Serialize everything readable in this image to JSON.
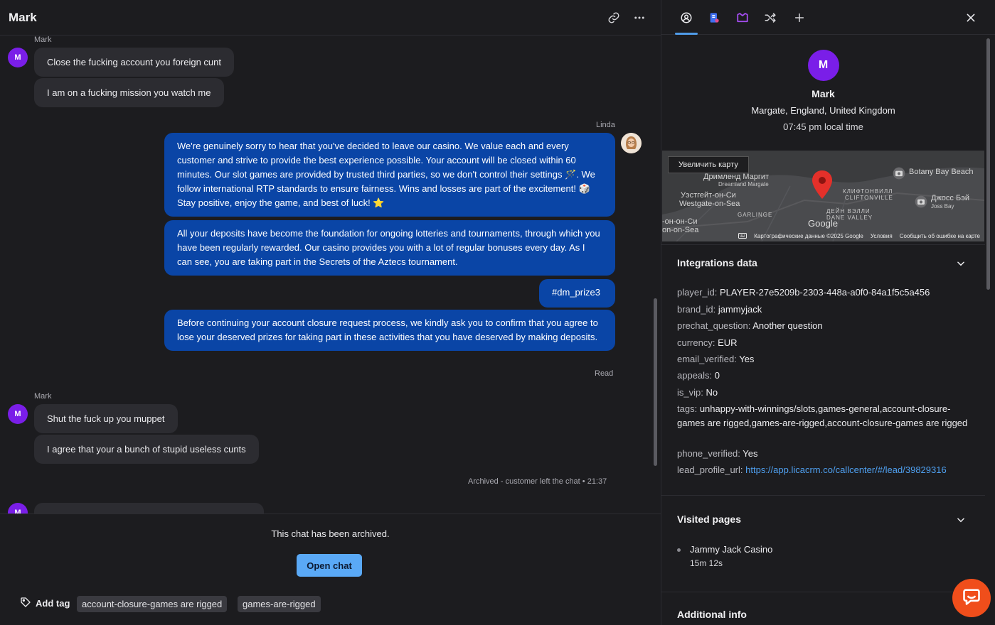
{
  "chat": {
    "title": "Mark",
    "messages_block1": {
      "author": "Mark",
      "avatar_letter": "M",
      "lines": [
        "Close the fucking account you foreign cunt",
        "I am on a fucking mission you watch me"
      ]
    },
    "agent_block": {
      "author": "Linda",
      "msg1": "We're genuinely sorry to hear that you've decided to leave our casino. We value each and every customer and strive to provide the best experience possible. Your account will be closed within 60 minutes. Our slot games are provided by trusted third parties, so we don't control their settings 🪄. We follow international RTP standards to ensure fairness. Wins and losses are part of the excitement! 🎲 Stay positive, enjoy the game, and best of luck! ⭐",
      "msg2": "All your deposits have become the foundation for ongoing lotteries and tournaments, through which you have been regularly rewarded. Our casino provides you with a lot of regular bonuses every day. As I can see, you are taking part in the Secrets of the Aztecs tournament.",
      "msg3": "#dm_prize3",
      "msg4": "Before continuing your account closure request process, we kindly ask you to confirm that you agree to lose your deserved prizes for taking part in these activities that you have deserved by making deposits.",
      "status": "Read"
    },
    "messages_block2": {
      "author": "Mark",
      "avatar_letter": "M",
      "lines": [
        "Shut the fuck up you muppet",
        "I agree that your a bunch of stupid useless cunts"
      ]
    },
    "archived_note": "Archived - customer left the chat • 21:37",
    "partial_avatar_letter": "M",
    "composer": {
      "archived_text": "This chat has been archived.",
      "open_chat": "Open chat",
      "add_tag": "Add tag",
      "tags": [
        "account-closure-games are rigged",
        "games-are-rigged"
      ]
    }
  },
  "side": {
    "profile": {
      "letter": "M",
      "name": "Mark",
      "location": "Margate, England, United Kingdom",
      "local_time": "07:45 pm local time"
    },
    "map": {
      "enlarge": "Увеличить карту",
      "labels": [
        "Дримленд Маргит",
        "Dreamland Margate",
        "Уэстгейт-он-Си",
        "Westgate-on-Sea",
        "Botany Bay Beach",
        "КЛИФТОНВИЛЛ",
        "CLIFTONVILLE",
        "Джосс Бэй",
        "Joss Bay",
        "ДЕЙН ВЭЛЛИ",
        "DANE VALLEY",
        "GARLINGE",
        "-он-он-Си",
        "on-on-Sea",
        "Google"
      ],
      "footer": [
        "Картографические данные ©2025 Google",
        "Условия",
        "Сообщить об ошибке на карте"
      ]
    },
    "integrations": {
      "title": "Integrations data",
      "rows": [
        {
          "k": "player_id:",
          "v": "PLAYER-27e5209b-2303-448a-a0f0-84a1f5c5a456"
        },
        {
          "k": "brand_id:",
          "v": "jammyjack"
        },
        {
          "k": "prechat_question:",
          "v": "Another question"
        },
        {
          "k": "currency:",
          "v": "EUR"
        },
        {
          "k": "email_verified:",
          "v": "Yes"
        },
        {
          "k": "appeals:",
          "v": "0"
        },
        {
          "k": "is_vip:",
          "v": "No"
        },
        {
          "k": "tags:",
          "v": "unhappy-with-winnings/slots,games-general,account-closure-games are rigged,games-are-rigged,account-closure-games are rigged"
        },
        {
          "k": "phone_verified:",
          "v": "Yes"
        },
        {
          "k": "lead_profile_url:",
          "v": "https://app.licacrm.co/callcenter/#/lead/39829316"
        }
      ]
    },
    "visited": {
      "title": "Visited pages",
      "page": "Jammy Jack Casino",
      "duration": "15m 12s"
    },
    "additional": {
      "title": "Additional info"
    }
  }
}
